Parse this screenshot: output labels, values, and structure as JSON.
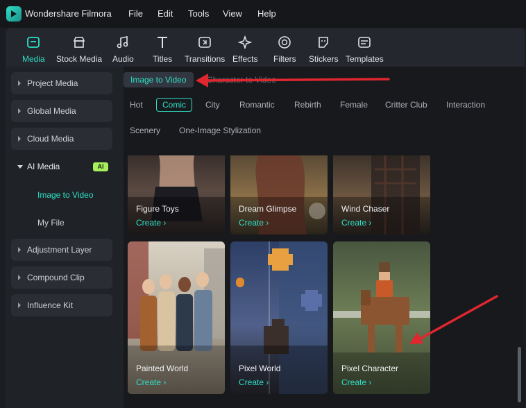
{
  "app": {
    "name": "Wondershare Filmora"
  },
  "menu": [
    "File",
    "Edit",
    "Tools",
    "View",
    "Help"
  ],
  "toolbar": [
    {
      "label": "Media",
      "icon": "media-icon",
      "active": true
    },
    {
      "label": "Stock Media",
      "icon": "stock-media-icon"
    },
    {
      "label": "Audio",
      "icon": "music-note-icon"
    },
    {
      "label": "Titles",
      "icon": "titles-icon"
    },
    {
      "label": "Transitions",
      "icon": "transitions-icon"
    },
    {
      "label": "Effects",
      "icon": "effects-icon"
    },
    {
      "label": "Filters",
      "icon": "filters-icon"
    },
    {
      "label": "Stickers",
      "icon": "stickers-icon"
    },
    {
      "label": "Templates",
      "icon": "templates-icon"
    }
  ],
  "sidebar": {
    "items": [
      {
        "label": "Project Media"
      },
      {
        "label": "Global Media"
      },
      {
        "label": "Cloud Media"
      },
      {
        "label": "AI Media",
        "badge": "AI",
        "expanded": true
      },
      {
        "label": "Adjustment Layer"
      },
      {
        "label": "Compound Clip"
      },
      {
        "label": "Influence Kit"
      }
    ],
    "subitems": [
      {
        "label": "Image to Video",
        "active": true
      },
      {
        "label": "My File"
      }
    ]
  },
  "subtabs": [
    "Image to Video",
    "Character to Video"
  ],
  "categories": [
    "Hot",
    "Comic",
    "City",
    "Romantic",
    "Rebirth",
    "Female",
    "Critter Club",
    "Interaction",
    "Scenery",
    "One-Image Stylization"
  ],
  "selected_category": "Comic",
  "cards": [
    {
      "title": "Figure Toys",
      "action": "Create ›"
    },
    {
      "title": "Dream Glimpse",
      "action": "Create ›"
    },
    {
      "title": "Wind Chaser",
      "action": "Create ›"
    },
    {
      "title": "Painted World",
      "action": "Create ›"
    },
    {
      "title": "Pixel World",
      "action": "Create ›"
    },
    {
      "title": "Pixel Character",
      "action": "Create ›"
    }
  ],
  "colors": {
    "accent": "#2de0c6",
    "annotation": "#e0262e",
    "ai_badge": "#a8f05a"
  }
}
